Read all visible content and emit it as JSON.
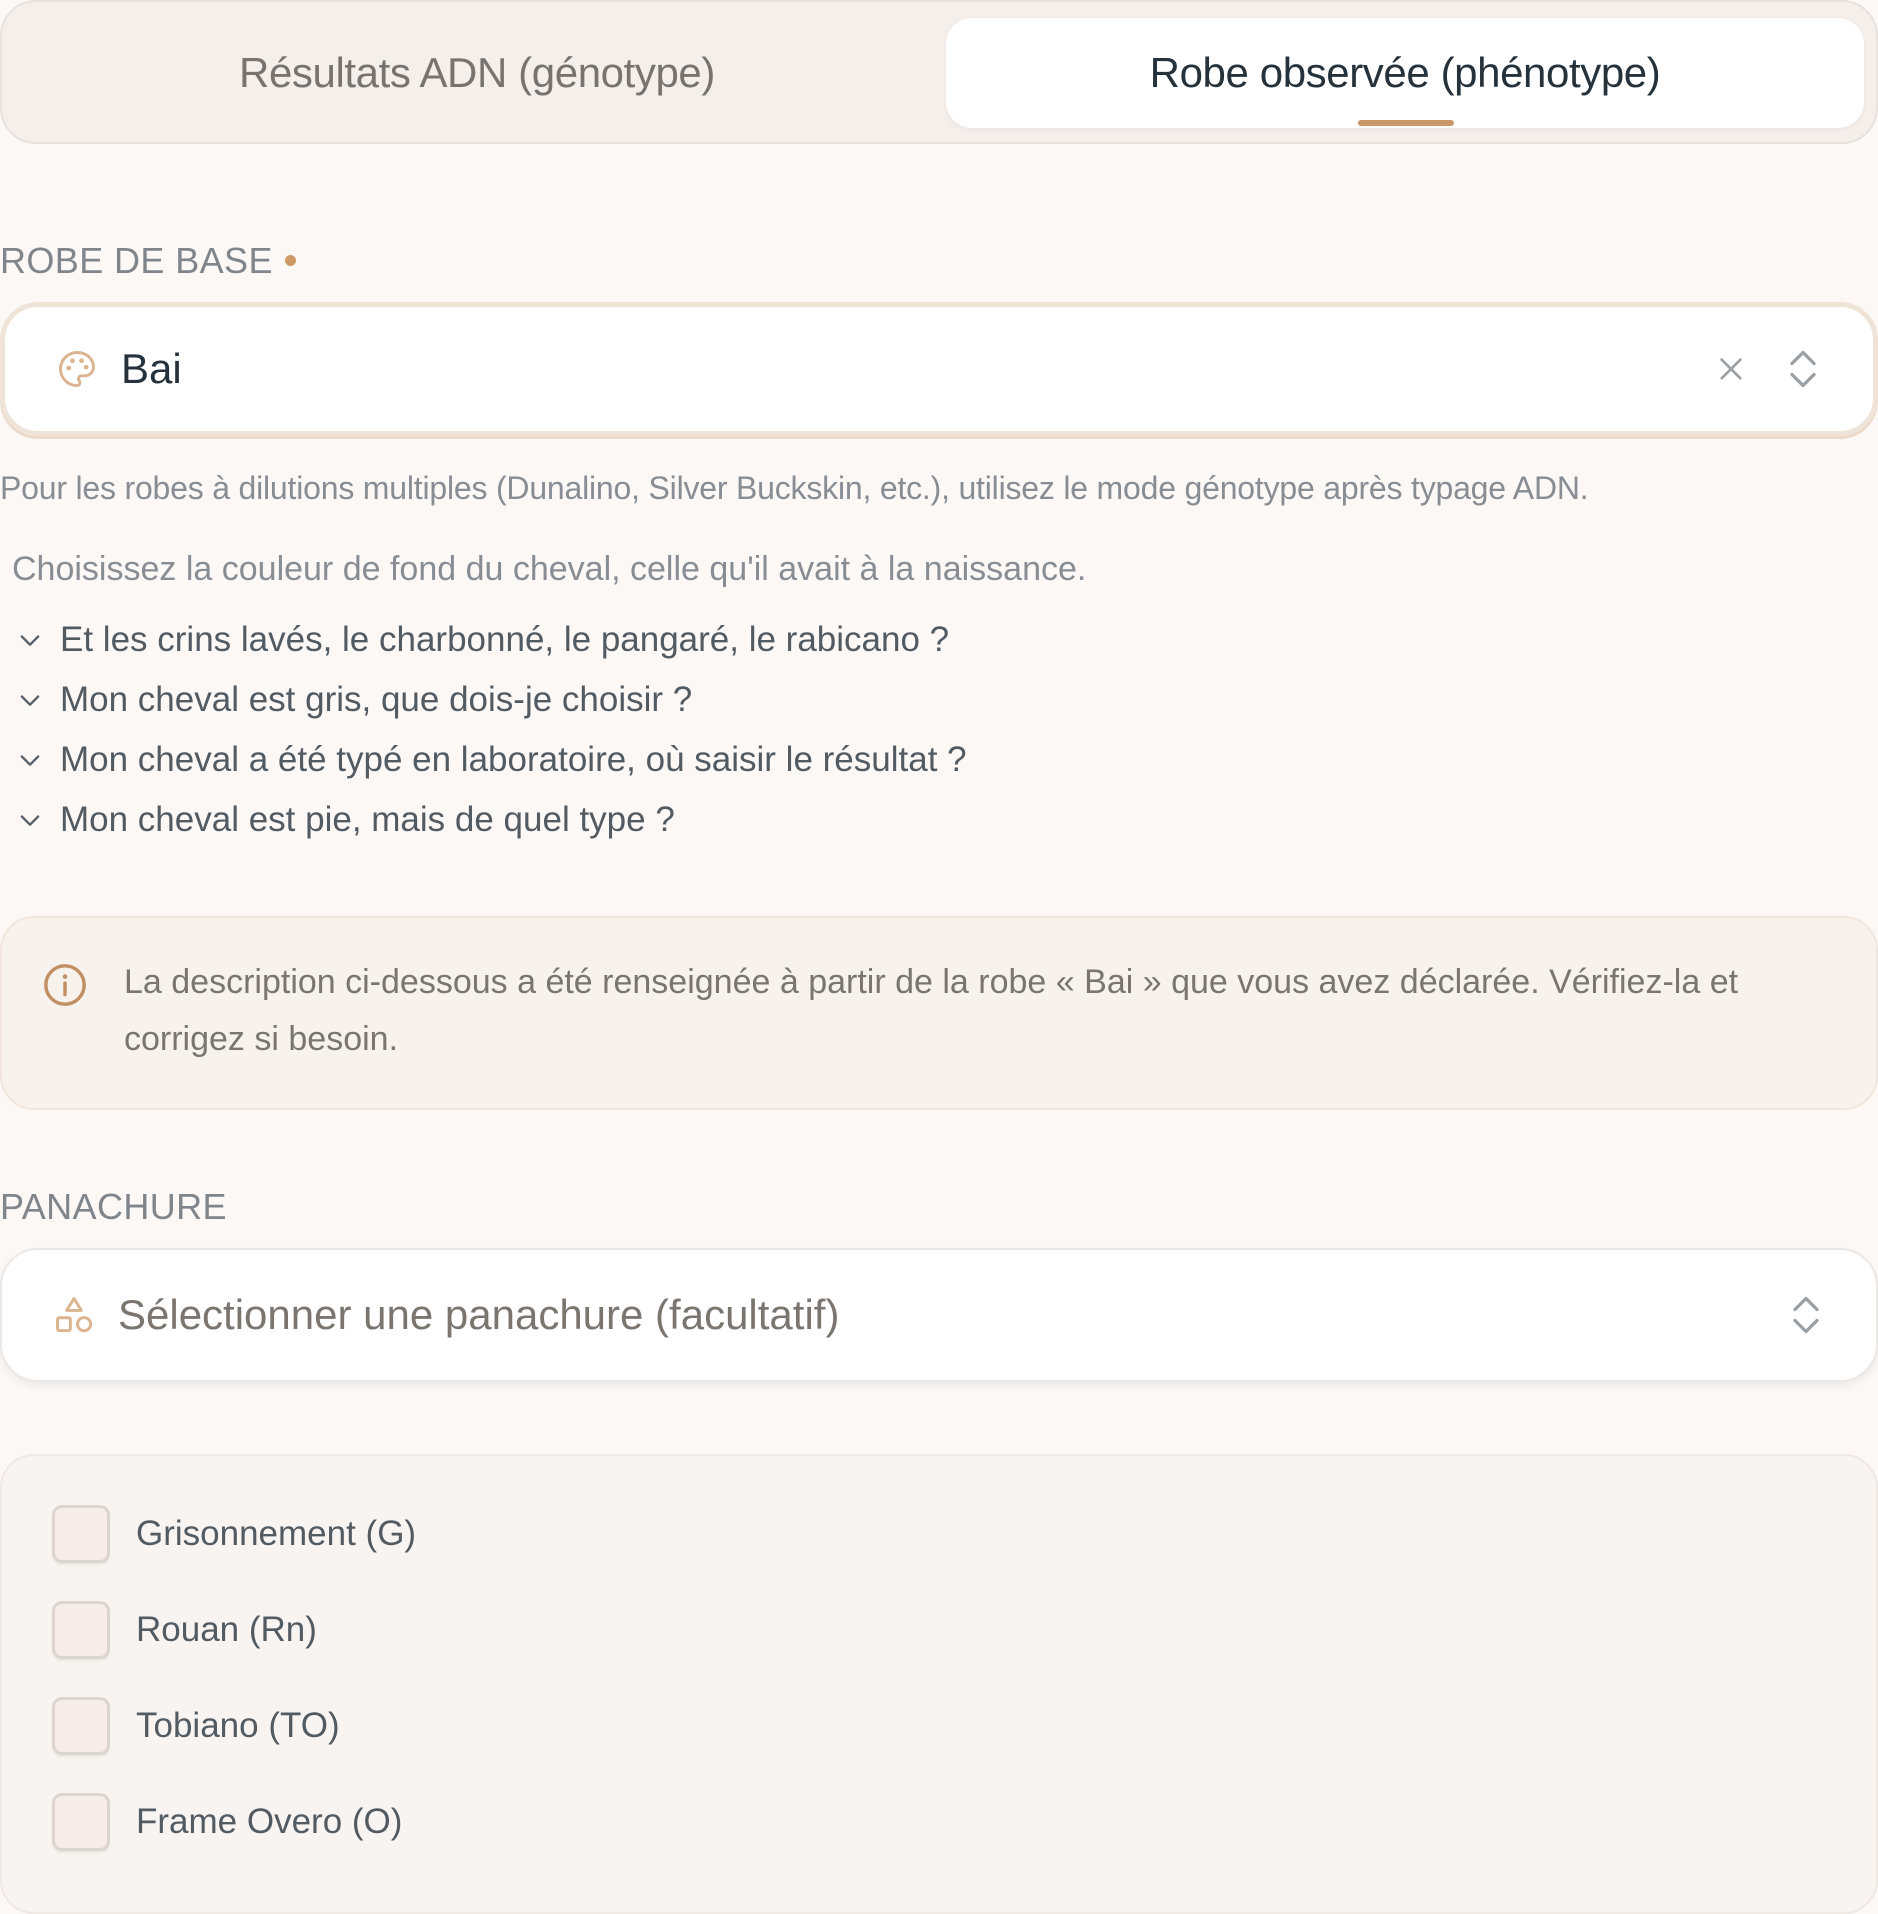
{
  "tabs": [
    {
      "label": "Résultats ADN (génotype)",
      "active": false
    },
    {
      "label": "Robe observée (phénotype)",
      "active": true
    }
  ],
  "base_coat": {
    "label": "ROBE DE BASE",
    "required": true,
    "value": "Bai",
    "icon": "palette-icon",
    "hint": "Pour les robes à dilutions multiples (Dunalino, Silver Buckskin, etc.), utilisez le mode génotype après typage ADN.",
    "instruction": "Choisissez la couleur de fond du cheval, celle qu'il avait à la naissance.",
    "faq": [
      "Et les crins lavés, le charbonné, le pangaré, le rabicano ?",
      "Mon cheval est gris, que dois-je choisir ?",
      "Mon cheval a été typé en laboratoire, où saisir le résultat ?",
      "Mon cheval est pie, mais de quel type ?"
    ]
  },
  "info_banner": {
    "text": "La description ci-dessous a été renseignée à partir de la robe « Bai » que vous avez déclarée. Vérifiez-la et corrigez si besoin."
  },
  "spotting": {
    "label": "PANACHURE",
    "placeholder": "Sélectionner une panachure (facultatif)",
    "icon": "shapes-icon"
  },
  "modifiers": [
    {
      "label": "Grisonnement (G)",
      "checked": false
    },
    {
      "label": "Rouan (Rn)",
      "checked": false
    },
    {
      "label": "Tobiano (TO)",
      "checked": false
    },
    {
      "label": "Frame Overo (O)",
      "checked": false
    }
  ],
  "colors": {
    "accent": "#c99668",
    "background": "#fbf8f6",
    "text_dark": "#26323b",
    "text_muted": "#878d93"
  }
}
